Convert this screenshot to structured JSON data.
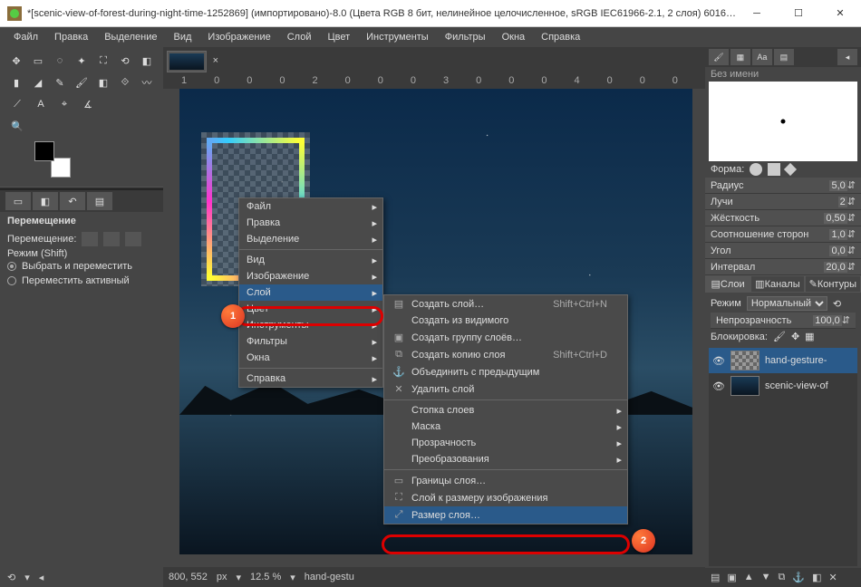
{
  "titlebar": {
    "text": "*[scenic-view-of-forest-during-night-time-1252869] (импортировано)-8.0 (Цвета RGB 8 бит, нелинейное целочисленное, sRGB IEC61966-2.1, 2 слоя) 6016x4..."
  },
  "menubar": [
    "Файл",
    "Правка",
    "Выделение",
    "Вид",
    "Изображение",
    "Слой",
    "Цвет",
    "Инструменты",
    "Фильтры",
    "Окна",
    "Справка"
  ],
  "ruler": [
    "1000",
    "2000",
    "3000",
    "4000"
  ],
  "leftpanel": {
    "title": "Перемещение",
    "moveLabel": "Перемещение:",
    "modeLabel": "Режим (Shift)",
    "opt1": "Выбрать и переместить",
    "opt2": "Переместить активный"
  },
  "status": {
    "coords": "800, 552",
    "unit": "px",
    "zoom": "12.5 %",
    "layer": "hand-gestu"
  },
  "rightpanel": {
    "brushTitle": "Без имени",
    "shapeLabel": "Форма:",
    "props": {
      "radius": {
        "k": "Радиус",
        "v": "5,0"
      },
      "spikes": {
        "k": "Лучи",
        "v": "2"
      },
      "hardness": {
        "k": "Жёсткость",
        "v": "0,50"
      },
      "aspect": {
        "k": "Соотношение сторон",
        "v": "1,0"
      },
      "angle": {
        "k": "Угол",
        "v": "0,0"
      },
      "spacing": {
        "k": "Интервал",
        "v": "20,0"
      }
    },
    "tabs": {
      "layers": "Слои",
      "channels": "Каналы",
      "paths": "Контуры"
    },
    "modeLabel": "Режим",
    "modeValue": "Нормальный",
    "opacityLabel": "Непрозрачность",
    "opacityValue": "100,0",
    "lockLabel": "Блокировка:",
    "layers": [
      {
        "name": "hand-gesture-"
      },
      {
        "name": "scenic-view-of"
      }
    ]
  },
  "cm1": [
    "Файл",
    "Правка",
    "Выделение",
    "Вид",
    "Изображение",
    "Слой",
    "Цвет",
    "Инструменты",
    "Фильтры",
    "Окна",
    "Справка"
  ],
  "cm2": {
    "newLayer": "Создать слой…",
    "newLayerShort": "Shift+Ctrl+N",
    "fromVisible": "Создать из видимого",
    "newGroup": "Создать группу слоёв…",
    "dup": "Создать копию слоя",
    "dupShort": "Shift+Ctrl+D",
    "mergePrev": "Объединить с предыдущим",
    "delete": "Удалить слой",
    "stack": "Стопка слоев",
    "mask": "Маска",
    "transparency": "Прозрачность",
    "transform": "Преобразования",
    "bounds": "Границы слоя…",
    "toImgSize": "Слой к размеру изображения",
    "layerSize": "Размер слоя…"
  },
  "markers": {
    "m1": "1",
    "m2": "2"
  }
}
